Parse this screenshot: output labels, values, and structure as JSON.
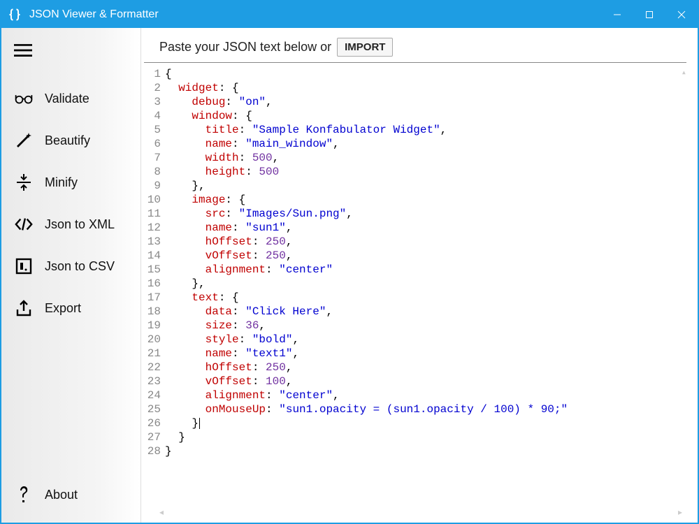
{
  "window": {
    "title": "JSON Viewer & Formatter"
  },
  "sidebar": {
    "items": [
      {
        "label": "Validate",
        "icon": "glasses-icon"
      },
      {
        "label": "Beautify",
        "icon": "wand-icon"
      },
      {
        "label": "Minify",
        "icon": "compress-icon"
      },
      {
        "label": "Json to XML",
        "icon": "code-icon"
      },
      {
        "label": "Json to CSV",
        "icon": "csv-icon"
      },
      {
        "label": "Export",
        "icon": "export-icon"
      }
    ],
    "about": {
      "label": "About",
      "icon": "question-icon"
    }
  },
  "main": {
    "instructions_prefix": "Paste your JSON text below or",
    "import_label": "IMPORT"
  },
  "editor": {
    "lines": [
      [
        {
          "t": "p",
          "v": "{"
        }
      ],
      [
        {
          "t": "p",
          "v": "  "
        },
        {
          "t": "k",
          "v": "widget"
        },
        {
          "t": "p",
          "v": ": {"
        }
      ],
      [
        {
          "t": "p",
          "v": "    "
        },
        {
          "t": "k",
          "v": "debug"
        },
        {
          "t": "p",
          "v": ": "
        },
        {
          "t": "s",
          "v": "\"on\""
        },
        {
          "t": "p",
          "v": ","
        }
      ],
      [
        {
          "t": "p",
          "v": "    "
        },
        {
          "t": "k",
          "v": "window"
        },
        {
          "t": "p",
          "v": ": {"
        }
      ],
      [
        {
          "t": "p",
          "v": "      "
        },
        {
          "t": "k",
          "v": "title"
        },
        {
          "t": "p",
          "v": ": "
        },
        {
          "t": "s",
          "v": "\"Sample Konfabulator Widget\""
        },
        {
          "t": "p",
          "v": ","
        }
      ],
      [
        {
          "t": "p",
          "v": "      "
        },
        {
          "t": "k",
          "v": "name"
        },
        {
          "t": "p",
          "v": ": "
        },
        {
          "t": "s",
          "v": "\"main_window\""
        },
        {
          "t": "p",
          "v": ","
        }
      ],
      [
        {
          "t": "p",
          "v": "      "
        },
        {
          "t": "k",
          "v": "width"
        },
        {
          "t": "p",
          "v": ": "
        },
        {
          "t": "n",
          "v": "500"
        },
        {
          "t": "p",
          "v": ","
        }
      ],
      [
        {
          "t": "p",
          "v": "      "
        },
        {
          "t": "k",
          "v": "height"
        },
        {
          "t": "p",
          "v": ": "
        },
        {
          "t": "n",
          "v": "500"
        }
      ],
      [
        {
          "t": "p",
          "v": "    },"
        }
      ],
      [
        {
          "t": "p",
          "v": "    "
        },
        {
          "t": "k",
          "v": "image"
        },
        {
          "t": "p",
          "v": ": {"
        }
      ],
      [
        {
          "t": "p",
          "v": "      "
        },
        {
          "t": "k",
          "v": "src"
        },
        {
          "t": "p",
          "v": ": "
        },
        {
          "t": "s",
          "v": "\"Images/Sun.png\""
        },
        {
          "t": "p",
          "v": ","
        }
      ],
      [
        {
          "t": "p",
          "v": "      "
        },
        {
          "t": "k",
          "v": "name"
        },
        {
          "t": "p",
          "v": ": "
        },
        {
          "t": "s",
          "v": "\"sun1\""
        },
        {
          "t": "p",
          "v": ","
        }
      ],
      [
        {
          "t": "p",
          "v": "      "
        },
        {
          "t": "k",
          "v": "hOffset"
        },
        {
          "t": "p",
          "v": ": "
        },
        {
          "t": "n",
          "v": "250"
        },
        {
          "t": "p",
          "v": ","
        }
      ],
      [
        {
          "t": "p",
          "v": "      "
        },
        {
          "t": "k",
          "v": "vOffset"
        },
        {
          "t": "p",
          "v": ": "
        },
        {
          "t": "n",
          "v": "250"
        },
        {
          "t": "p",
          "v": ","
        }
      ],
      [
        {
          "t": "p",
          "v": "      "
        },
        {
          "t": "k",
          "v": "alignment"
        },
        {
          "t": "p",
          "v": ": "
        },
        {
          "t": "s",
          "v": "\"center\""
        }
      ],
      [
        {
          "t": "p",
          "v": "    },"
        }
      ],
      [
        {
          "t": "p",
          "v": "    "
        },
        {
          "t": "k",
          "v": "text"
        },
        {
          "t": "p",
          "v": ": {"
        }
      ],
      [
        {
          "t": "p",
          "v": "      "
        },
        {
          "t": "k",
          "v": "data"
        },
        {
          "t": "p",
          "v": ": "
        },
        {
          "t": "s",
          "v": "\"Click Here\""
        },
        {
          "t": "p",
          "v": ","
        }
      ],
      [
        {
          "t": "p",
          "v": "      "
        },
        {
          "t": "k",
          "v": "size"
        },
        {
          "t": "p",
          "v": ": "
        },
        {
          "t": "n",
          "v": "36"
        },
        {
          "t": "p",
          "v": ","
        }
      ],
      [
        {
          "t": "p",
          "v": "      "
        },
        {
          "t": "k",
          "v": "style"
        },
        {
          "t": "p",
          "v": ": "
        },
        {
          "t": "s",
          "v": "\"bold\""
        },
        {
          "t": "p",
          "v": ","
        }
      ],
      [
        {
          "t": "p",
          "v": "      "
        },
        {
          "t": "k",
          "v": "name"
        },
        {
          "t": "p",
          "v": ": "
        },
        {
          "t": "s",
          "v": "\"text1\""
        },
        {
          "t": "p",
          "v": ","
        }
      ],
      [
        {
          "t": "p",
          "v": "      "
        },
        {
          "t": "k",
          "v": "hOffset"
        },
        {
          "t": "p",
          "v": ": "
        },
        {
          "t": "n",
          "v": "250"
        },
        {
          "t": "p",
          "v": ","
        }
      ],
      [
        {
          "t": "p",
          "v": "      "
        },
        {
          "t": "k",
          "v": "vOffset"
        },
        {
          "t": "p",
          "v": ": "
        },
        {
          "t": "n",
          "v": "100"
        },
        {
          "t": "p",
          "v": ","
        }
      ],
      [
        {
          "t": "p",
          "v": "      "
        },
        {
          "t": "k",
          "v": "alignment"
        },
        {
          "t": "p",
          "v": ": "
        },
        {
          "t": "s",
          "v": "\"center\""
        },
        {
          "t": "p",
          "v": ","
        }
      ],
      [
        {
          "t": "p",
          "v": "      "
        },
        {
          "t": "k",
          "v": "onMouseUp"
        },
        {
          "t": "p",
          "v": ": "
        },
        {
          "t": "s",
          "v": "\"sun1.opacity = (sun1.opacity / 100) * 90;\""
        }
      ],
      [
        {
          "t": "p",
          "v": "    }"
        },
        {
          "t": "cursor",
          "v": ""
        }
      ],
      [
        {
          "t": "p",
          "v": "  }"
        }
      ],
      [
        {
          "t": "p",
          "v": "}"
        }
      ]
    ]
  }
}
